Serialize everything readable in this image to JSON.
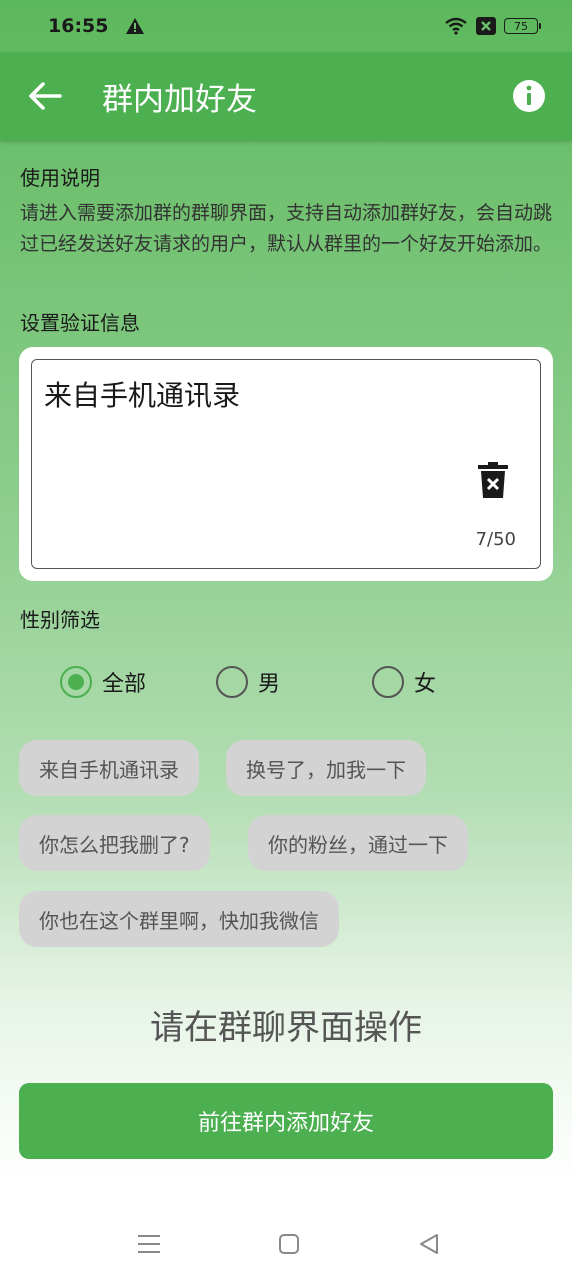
{
  "status_bar": {
    "time": "16:55",
    "battery": "75"
  },
  "app_bar": {
    "title": "群内加好友"
  },
  "instructions": {
    "label": "使用说明",
    "text": "请进入需要添加群的群聊界面，支持自动添加群好友，会自动跳过已经发送好友请求的用户，默认从群里的一个好友开始添加。"
  },
  "verify": {
    "label": "设置验证信息",
    "value": "来自手机通讯录",
    "counter": "7/50"
  },
  "gender": {
    "label": "性别筛选",
    "options": [
      "全部",
      "男",
      "女"
    ],
    "selected": "全部"
  },
  "chips": [
    "来自手机通讯录",
    "换号了，加我一下",
    "你怎么把我删了?",
    "你的粉丝，通过一下",
    "你也在这个群里啊，快加我微信"
  ],
  "hint": "请在群聊界面操作",
  "primary_button": "前往群内添加好友",
  "colors": {
    "accent": "#4caf50",
    "chip": "#d3d3d3"
  }
}
